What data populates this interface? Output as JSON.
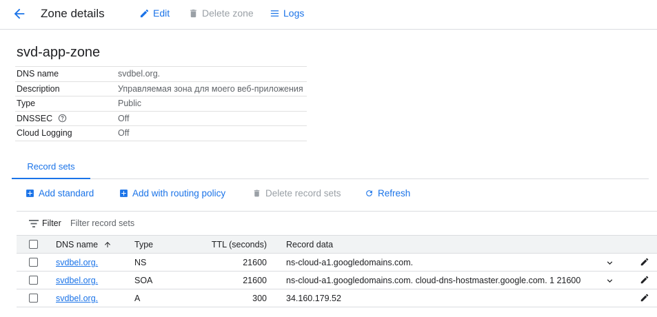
{
  "header": {
    "title": "Zone details",
    "edit_label": "Edit",
    "delete_label": "Delete zone",
    "logs_label": "Logs"
  },
  "zone": {
    "name": "svd-app-zone",
    "details": [
      {
        "key": "DNS name",
        "value": "svdbel.org."
      },
      {
        "key": "Description",
        "value": "Управляемая зона для моего веб-приложения"
      },
      {
        "key": "Type",
        "value": "Public"
      },
      {
        "key": "DNSSEC",
        "value": "Off"
      },
      {
        "key": "Cloud Logging",
        "value": "Off"
      }
    ]
  },
  "tabs": [
    {
      "label": "Record sets"
    }
  ],
  "toolbar": {
    "add_standard": "Add standard",
    "add_routing": "Add with routing policy",
    "delete_sets": "Delete record sets",
    "refresh": "Refresh"
  },
  "filter": {
    "label": "Filter",
    "placeholder": "Filter record sets"
  },
  "table": {
    "columns": {
      "name": "DNS name",
      "type": "Type",
      "ttl": "TTL (seconds)",
      "data": "Record data"
    },
    "rows": [
      {
        "name": "svdbel.org.",
        "type": "NS",
        "ttl": "21600",
        "data": "ns-cloud-a1.googledomains.com."
      },
      {
        "name": "svdbel.org.",
        "type": "SOA",
        "ttl": "21600",
        "data": "ns-cloud-a1.googledomains.com. cloud-dns-hostmaster.google.com. 1 21600"
      },
      {
        "name": "svdbel.org.",
        "type": "A",
        "ttl": "300",
        "data": "34.160.179.52"
      }
    ]
  },
  "colors": {
    "accent": "#1a73e8",
    "disabled": "#9aa0a6",
    "divider": "#dadce0"
  }
}
